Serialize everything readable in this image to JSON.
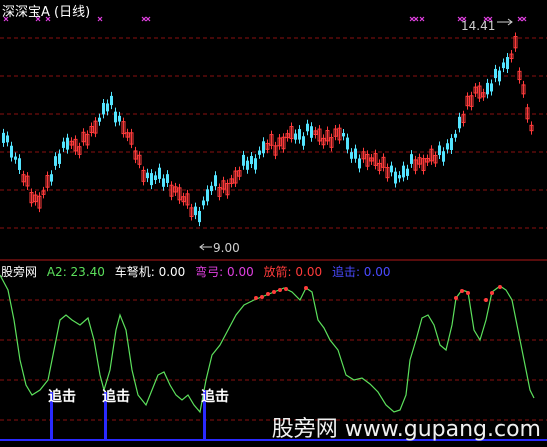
{
  "header": {
    "title": "深深宝A (日线)"
  },
  "labels": {
    "high": "14.41",
    "low": "9.00"
  },
  "indicator": {
    "name": "股旁网",
    "a2": "A2: 23.40",
    "chenuji": "车弩机: 0.00",
    "nugong": "弯弓: 0.00",
    "fangjian": "放箭: 0.00",
    "zhuiji": "追击: 0.00"
  },
  "signals": {
    "text": "追击"
  },
  "watermark": "股旁网 www.gupang.com",
  "colors": {
    "up": "#ff3b3b",
    "down": "#54e4ff",
    "osc": "#5ce05c",
    "marker": "#e040e0",
    "grid": "#8a1010",
    "blue": "#2a2aff"
  }
}
